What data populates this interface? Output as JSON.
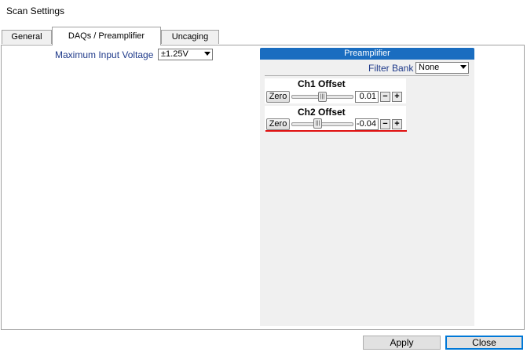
{
  "window": {
    "title": "Scan Settings"
  },
  "tabs": [
    {
      "label": "General",
      "active": false
    },
    {
      "label": "DAQs / Preamplifier",
      "active": true
    },
    {
      "label": "Uncaging",
      "active": false
    }
  ],
  "daq": {
    "max_input_voltage_label": "Maximum Input Voltage",
    "max_input_voltage_value": "±1.25V"
  },
  "preamplifier": {
    "header": "Preamplifier",
    "filter_bank_label": "Filter Bank",
    "filter_bank_value": "None",
    "channels": [
      {
        "title": "Ch1 Offset",
        "zero_label": "Zero",
        "value": "0.01",
        "minus": "−",
        "plus": "+"
      },
      {
        "title": "Ch2 Offset",
        "zero_label": "Zero",
        "value": "-0.04",
        "minus": "−",
        "plus": "+"
      }
    ]
  },
  "buttons": {
    "apply": "Apply",
    "close": "Close"
  },
  "colors": {
    "header_blue": "#1a6dc0",
    "label_blue": "#1f3a8a",
    "highlight_red": "#e01010"
  }
}
